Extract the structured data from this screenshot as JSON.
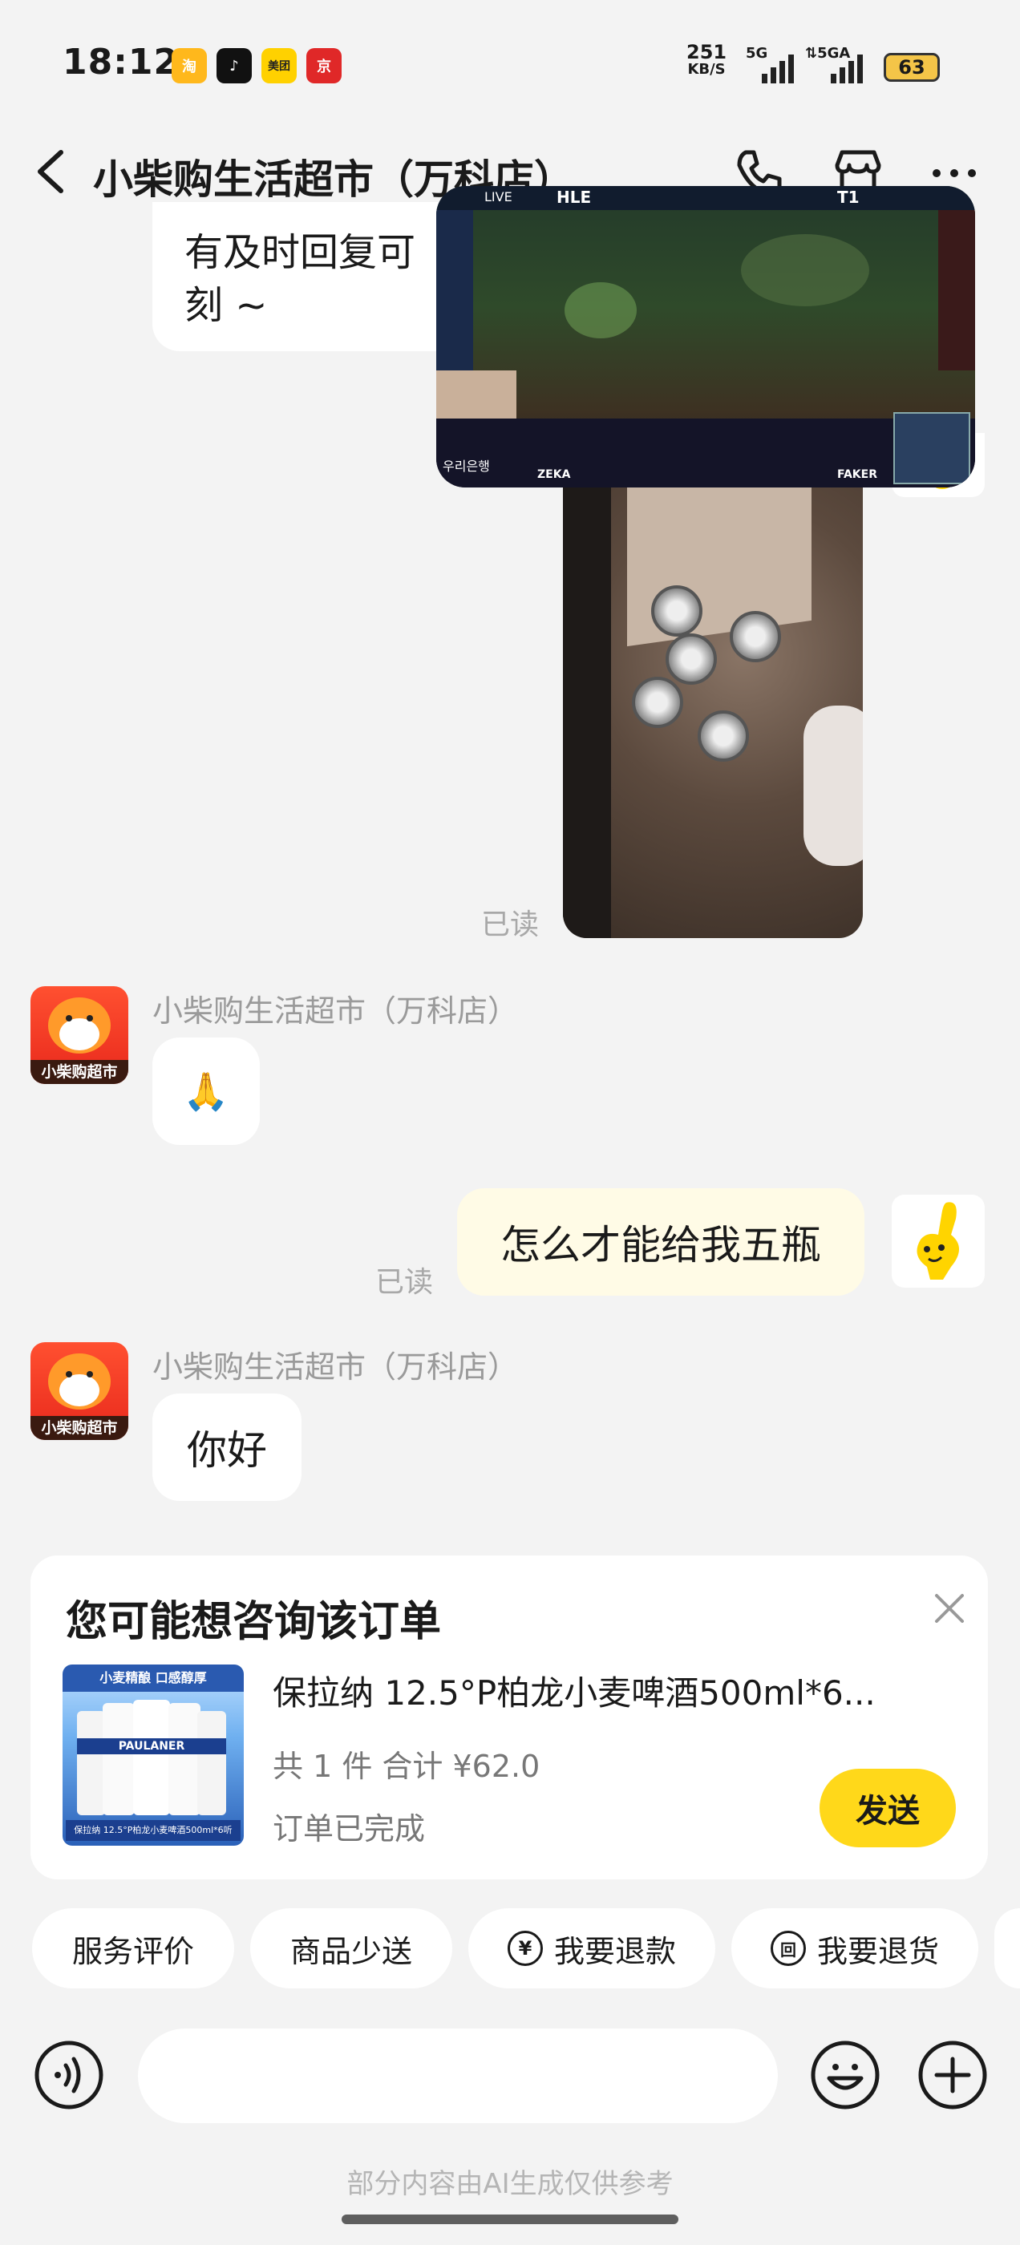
{
  "status_bar": {
    "time": "18:12",
    "app_icons": [
      {
        "name": "taobao-app-icon",
        "label": "淘",
        "color": "#ffb81c"
      },
      {
        "name": "douyin-app-icon",
        "label": "♪",
        "color": "#111111"
      },
      {
        "name": "meituan-app-icon",
        "label": "美团",
        "color": "#ffd100"
      },
      {
        "name": "jd-app-icon",
        "label": "京",
        "color": "#e02828"
      }
    ],
    "net_speed_value": "251",
    "net_speed_unit": "KB/S",
    "signal1_label": "5G",
    "signal2_label": "5GA",
    "battery": "63"
  },
  "header": {
    "title": "小柴购生活超市（万科店）"
  },
  "messages": {
    "partial_text_line1": "有及时回复可",
    "partial_text_line2": "刻 ~",
    "read_label_1": "已读",
    "shop_name_1": "小柴购生活超市（万科店）",
    "shop_reply_1": "🙏",
    "user_text": "怎么才能给我五瓶",
    "read_label_2": "已读",
    "shop_name_2": "小柴购生活超市（万科店）",
    "shop_reply_2": "你好"
  },
  "shop_avatar_label": "小柴购超市",
  "video_overlay": {
    "team_left": "HLE",
    "team_right": "T1",
    "player_left": "ZEKA",
    "player_right": "FAKER",
    "sponsor": "우리은행",
    "live_label": "LIVE"
  },
  "order_card": {
    "title": "您可能想咨询该订单",
    "product_title": "保拉纳 12.5°P柏龙小麦啤酒500ml*6...",
    "summary": "共 1 件 合计 ¥62.0",
    "status": "订单已完成",
    "send_label": "发送",
    "thumb_banner": "小麦精酿 口感醇厚",
    "thumb_brand": "PAULANER",
    "thumb_caption": "保拉纳 12.5°P柏龙小麦啤酒500ml*6听"
  },
  "quick_actions": [
    {
      "label": "服务评价",
      "icon": ""
    },
    {
      "label": "商品少送",
      "icon": ""
    },
    {
      "label": "我要退款",
      "icon": "¥"
    },
    {
      "label": "我要退货",
      "icon": "回"
    }
  ],
  "input_bar": {
    "placeholder": ""
  },
  "footer_note": "部分内容由AI生成仅供参考",
  "colors": {
    "accent_yellow": "#ffd81a",
    "background": "#f3f3f3",
    "user_bubble": "#fffbe6"
  }
}
